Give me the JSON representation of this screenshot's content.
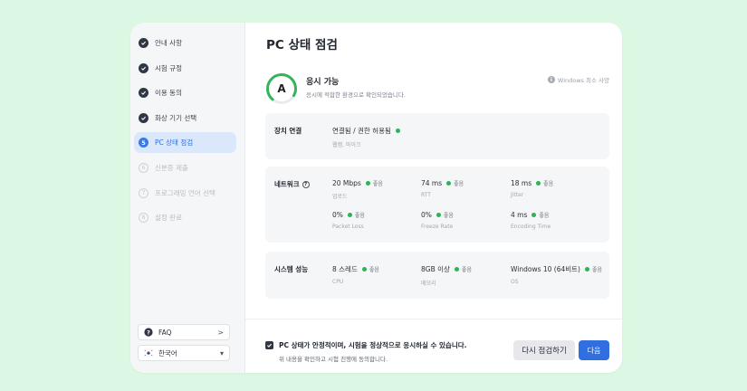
{
  "colors": {
    "background": "#dcf7e3",
    "accent": "#2f6fdf",
    "good": "#2fb15a",
    "grade_ring": "#34b45a"
  },
  "sidebar": {
    "steps": [
      {
        "label": "안내 사항",
        "state": "done"
      },
      {
        "label": "시험 규정",
        "state": "done"
      },
      {
        "label": "이용 동의",
        "state": "done"
      },
      {
        "label": "화상 기기 선택",
        "state": "done"
      },
      {
        "label": "PC 상태 점검",
        "state": "active",
        "number": "5"
      },
      {
        "label": "신분증 제출",
        "state": "pending",
        "number": "6"
      },
      {
        "label": "프로그래밍 언어 선택",
        "state": "pending",
        "number": "7"
      },
      {
        "label": "설정 완료",
        "state": "pending",
        "number": "8"
      }
    ],
    "faq_label": "FAQ",
    "faq_arrow": ">",
    "language_label": "한국어",
    "language_arrow": "▾"
  },
  "main": {
    "title": "PC 상태 점검",
    "grade": {
      "letter": "A",
      "ring_fraction": 0.72
    },
    "status_title": "응시 가능",
    "status_desc": "응시에 적합한 환경으로 확인되었습니다.",
    "requirements_link": "Windows 최소 사양"
  },
  "device": {
    "label": "장치 연결",
    "value": "연결됨 / 권한 허용됨",
    "sub": "웹캠, 마이크"
  },
  "network": {
    "label": "네트워크",
    "help": "?",
    "metrics": [
      {
        "value": "20 Mbps",
        "status": "좋음",
        "name": "업로드"
      },
      {
        "value": "74 ms",
        "status": "좋음",
        "name": "RTT"
      },
      {
        "value": "18 ms",
        "status": "좋음",
        "name": "Jitter"
      },
      {
        "value": "0%",
        "status": "좋음",
        "name": "Packet Loss"
      },
      {
        "value": "0%",
        "status": "좋음",
        "name": "Freeze Rate"
      },
      {
        "value": "4 ms",
        "status": "좋음",
        "name": "Encoding Time"
      }
    ]
  },
  "system": {
    "label": "시스템 성능",
    "metrics": [
      {
        "value": "8 스레드",
        "status": "좋음",
        "name": "CPU"
      },
      {
        "value": "8GB 이상",
        "status": "좋음",
        "name": "메모리"
      },
      {
        "value": "Windows 10 (64비트)",
        "status": "좋음",
        "name": "OS"
      }
    ]
  },
  "footer": {
    "agree_main": "PC 상태가 안정적이며, 시험을 정상적으로 응시하실 수 있습니다.",
    "agree_sub": "위 내용을 확인하고 시험 진행에 동의합니다.",
    "recheck_label": "다시 점검하기",
    "next_label": "다음"
  }
}
